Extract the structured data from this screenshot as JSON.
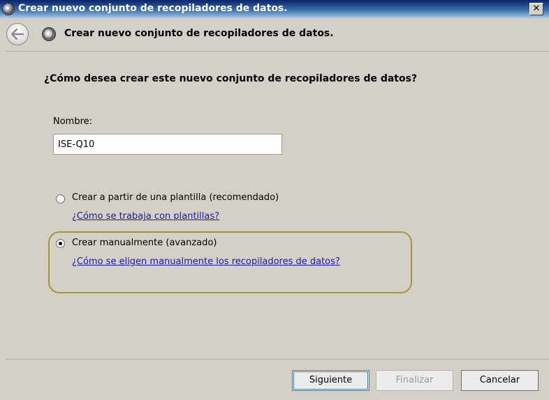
{
  "window": {
    "title": "Crear nuevo conjunto de recopiladores de datos.",
    "close_icon": "close-icon"
  },
  "nav": {
    "back_icon": "back-arrow-icon",
    "wizard_icon": "data-collector-icon",
    "title": "Crear nuevo conjunto de recopiladores de datos."
  },
  "main": {
    "question": "¿Cómo desea crear este nuevo conjunto de recopiladores de datos?",
    "name_label": "Nombre:",
    "name_value": "ISE-Q10",
    "options": [
      {
        "label": "Crear a partir de una plantilla (recomendado)",
        "link": "¿Cómo se trabaja con plantillas?",
        "selected": false
      },
      {
        "label": "Crear manualmente (avanzado)",
        "link": "¿Cómo se eligen manualmente los recopiladores de datos?",
        "selected": true
      }
    ]
  },
  "footer": {
    "next": "Siguiente",
    "finish": "Finalizar",
    "cancel": "Cancelar"
  },
  "colors": {
    "highlight_border": "#9e9a3b",
    "link": "#1a1aa6"
  }
}
